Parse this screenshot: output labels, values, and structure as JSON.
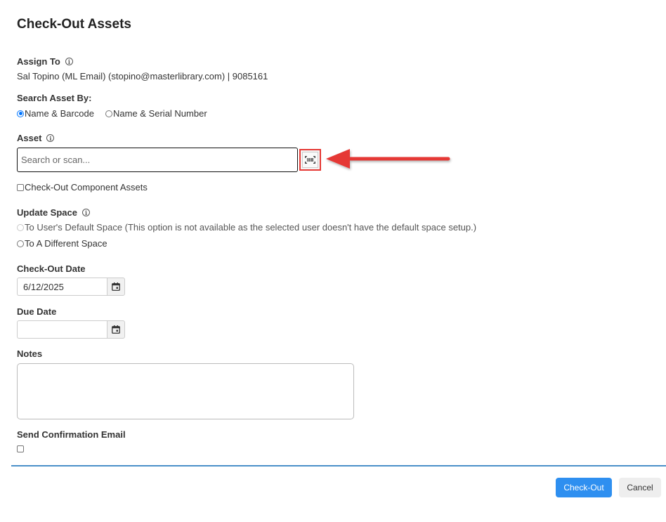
{
  "page": {
    "title": "Check-Out Assets"
  },
  "assign_to": {
    "label": "Assign To",
    "value": "Sal Topino (ML Email) (stopino@masterlibrary.com) | 9085161"
  },
  "search_by": {
    "label": "Search Asset By:",
    "options": [
      {
        "label": "Name & Barcode",
        "checked": true
      },
      {
        "label": "Name & Serial Number",
        "checked": false
      }
    ]
  },
  "asset": {
    "label": "Asset",
    "placeholder": "Search or scan...",
    "value": "",
    "scan_icon": "barcode-scan-icon",
    "component_checkbox_label": "Check-Out Component Assets"
  },
  "update_space": {
    "label": "Update Space",
    "options": [
      {
        "label": "To User's Default Space (This option is not available as the selected user doesn't have the default space setup.)",
        "disabled": true
      },
      {
        "label": "To A Different Space",
        "disabled": false
      }
    ]
  },
  "checkout_date": {
    "label": "Check-Out Date",
    "value": "6/12/2025"
  },
  "due_date": {
    "label": "Due Date",
    "value": ""
  },
  "notes": {
    "label": "Notes",
    "value": ""
  },
  "confirmation": {
    "label": "Send Confirmation Email"
  },
  "footer": {
    "checkout_label": "Check-Out",
    "cancel_label": "Cancel"
  },
  "colors": {
    "primary": "#2e8ff0",
    "annotation": "#e53935",
    "divider": "#4a90c8"
  }
}
